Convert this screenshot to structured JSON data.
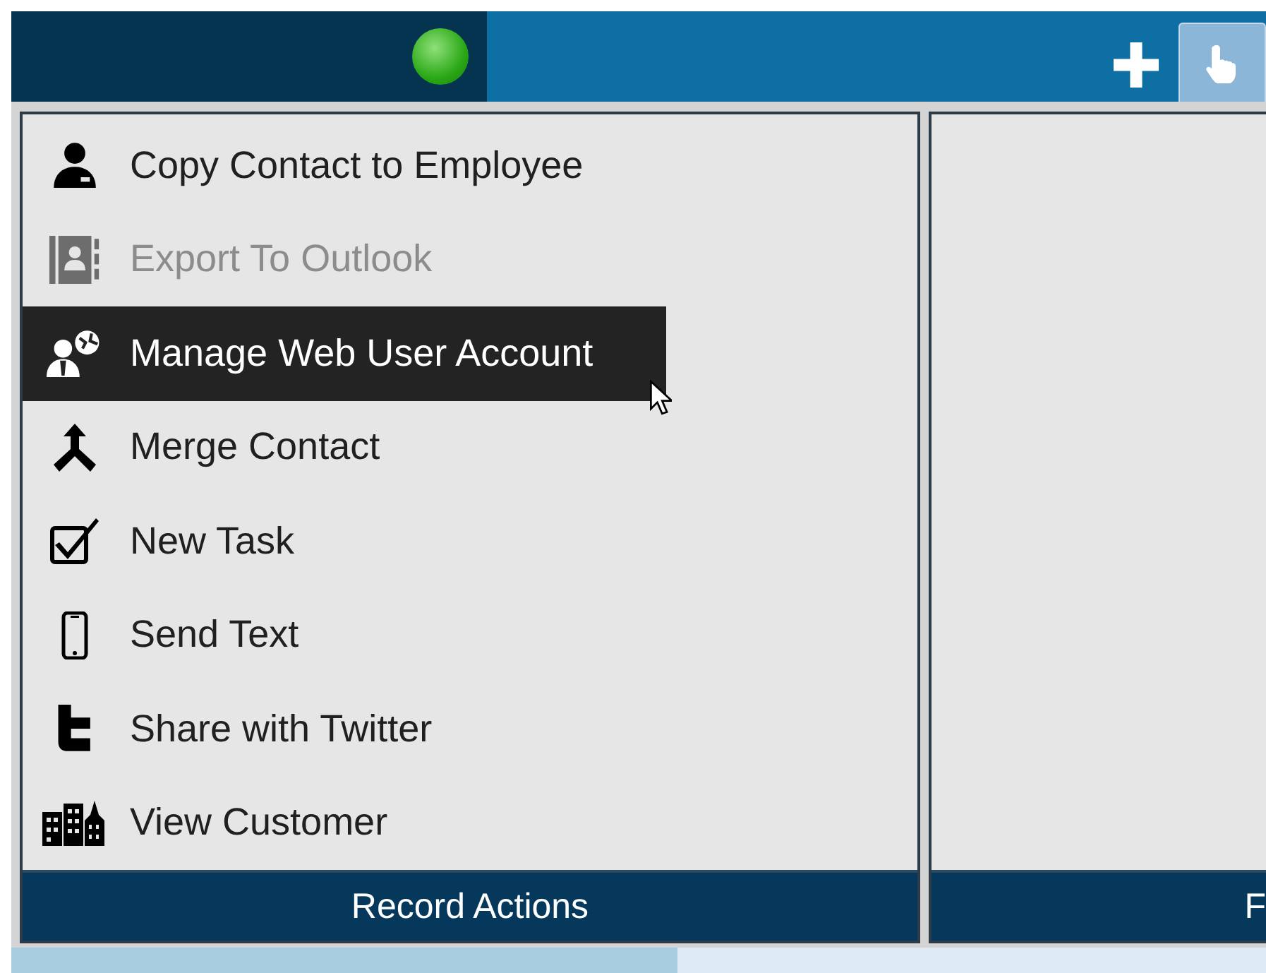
{
  "top_bar": {
    "status_on": true
  },
  "panels": [
    {
      "items": [
        {
          "label": "Copy Contact to Employee",
          "disabled": false,
          "highlighted": false
        },
        {
          "label": "Export To Outlook",
          "disabled": true,
          "highlighted": false
        },
        {
          "label": "Manage Web User Account",
          "disabled": false,
          "highlighted": true
        },
        {
          "label": "Merge Contact",
          "disabled": false,
          "highlighted": false
        },
        {
          "label": "New Task",
          "disabled": false,
          "highlighted": false
        },
        {
          "label": "Send Text",
          "disabled": false,
          "highlighted": false
        },
        {
          "label": "Share with Twitter",
          "disabled": false,
          "highlighted": false
        },
        {
          "label": "View Customer",
          "disabled": false,
          "highlighted": false
        }
      ],
      "footer": "Record Actions"
    },
    {
      "footer": "F"
    }
  ]
}
